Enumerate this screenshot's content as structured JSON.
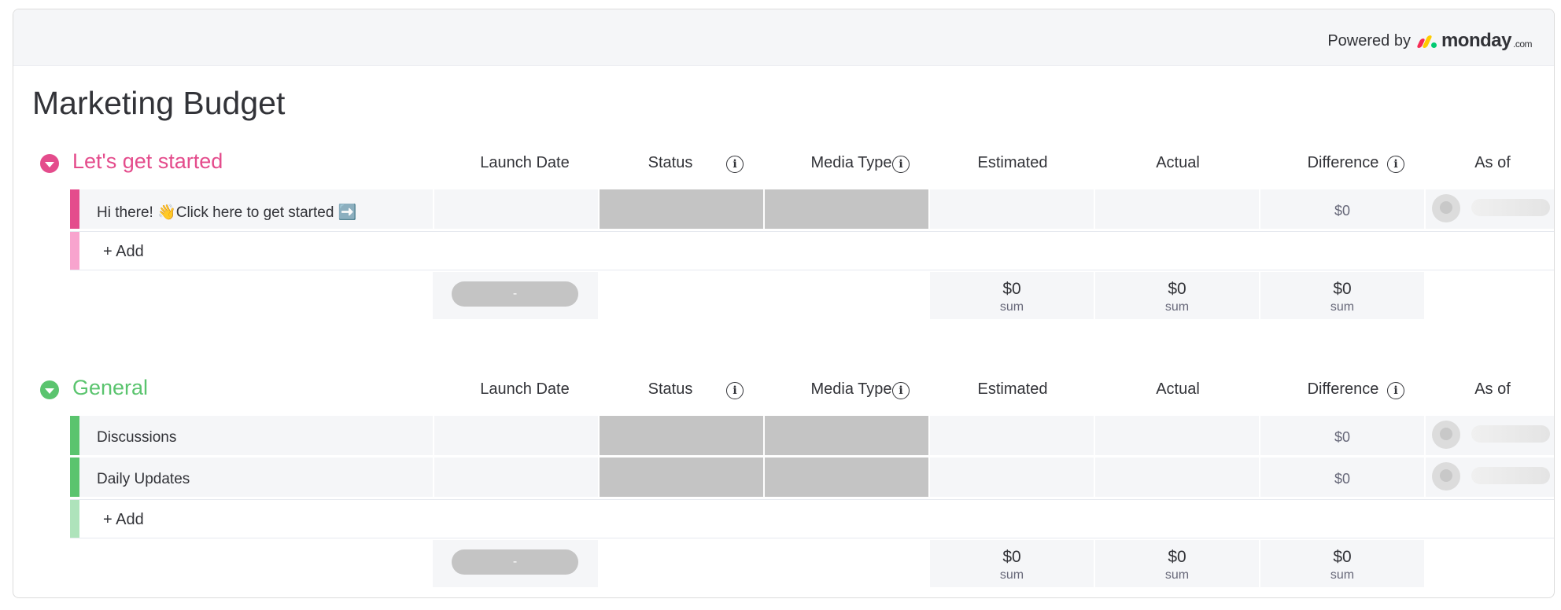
{
  "header": {
    "powered_by": "Powered by",
    "brand": "monday",
    "brand_suffix": ".com"
  },
  "board": {
    "title": "Marketing Budget"
  },
  "columns": {
    "launch_date": "Launch Date",
    "status": "Status",
    "media_type": "Media Type",
    "estimated": "Estimated",
    "actual": "Actual",
    "difference": "Difference",
    "as_of": "As of",
    "info_glyph": "i"
  },
  "groups": [
    {
      "title": "Let's get started",
      "color": "#e2445c",
      "title_color": "#e2445c",
      "bar_color": "#e44c8c",
      "add_bar_color": "#f8a4ce",
      "items": [
        {
          "name": "Hi there! 👋Click here to get started ➡️",
          "difference": "$0"
        }
      ],
      "add_label": "+ Add",
      "summary": {
        "date": "-",
        "estimated": "$0",
        "actual": "$0",
        "difference": "$0",
        "sum_label": "sum"
      }
    },
    {
      "title": "General",
      "color": "#5ac46e",
      "title_color": "#5ac46e",
      "bar_color": "#5ac46e",
      "add_bar_color": "#aee3bb",
      "items": [
        {
          "name": "Discussions",
          "difference": "$0"
        },
        {
          "name": "Daily Updates",
          "difference": "$0"
        }
      ],
      "add_label": "+ Add",
      "summary": {
        "date": "-",
        "estimated": "$0",
        "actual": "$0",
        "difference": "$0",
        "sum_label": "sum"
      }
    }
  ]
}
